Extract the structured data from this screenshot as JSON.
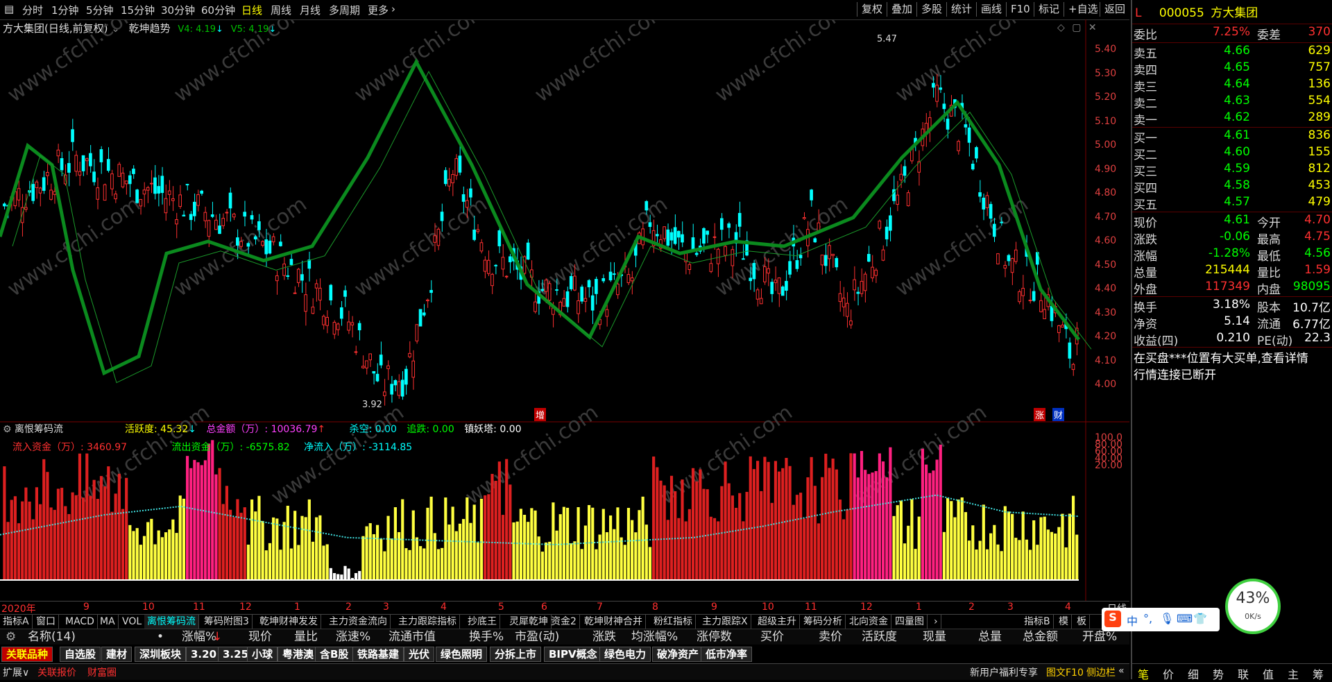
{
  "toolbar": {
    "periods": [
      "分时",
      "1分钟",
      "5分钟",
      "15分钟",
      "30分钟",
      "60分钟",
      "日线",
      "周线",
      "月线",
      "多周期",
      "更多"
    ],
    "active_period": "日线",
    "right_buttons": [
      "复权",
      "叠加",
      "多股",
      "统计",
      "画线",
      "F10",
      "标记",
      "+自选",
      "返回"
    ]
  },
  "main_chart": {
    "title": "方大集团(日线,前复权)",
    "indicator": "乾坤趋势",
    "v4_label": "V4: 4.19",
    "v5_label": "V5: 4.19",
    "high_mark": "5.47",
    "low_mark": "3.92",
    "price_ticks": [
      "5.40",
      "5.30",
      "5.20",
      "5.10",
      "5.00",
      "4.90",
      "4.80",
      "4.70",
      "4.60",
      "4.50",
      "4.40",
      "4.30",
      "4.20",
      "4.10",
      "4.00"
    ],
    "flags": [
      "增",
      "涨",
      "财"
    ],
    "watermark": "www.cfchi.com"
  },
  "sub_chart": {
    "name": "离恨筹码流",
    "active": "活跃度: 45.32",
    "total": "总金额（万）: 10036.79",
    "kill": "杀空: 0.00",
    "chase": "追跌: 0.00",
    "town": "镇妖塔: 0.00",
    "inflow": "流入资金（万）: 3460.97",
    "outflow": "流出资金（万）: -6575.82",
    "net": "净流入（万）: -3114.85",
    "ticks": [
      "100.0",
      "80.00",
      "60.00",
      "40.00",
      "20.00"
    ]
  },
  "time_axis": [
    "2020年",
    "9",
    "10",
    "11",
    "12",
    "1",
    "2",
    "3",
    "4",
    "5",
    "6",
    "7",
    "8",
    "9",
    "10",
    "11",
    "12",
    "1",
    "2",
    "3",
    "4"
  ],
  "time_axis_right": "日线",
  "indicator_tabs": [
    "指标A",
    "窗口",
    "MACD",
    "MA",
    "VOL",
    "离恨筹码流",
    "筹码附图3",
    "乾坤财神发发",
    "主力资金流向",
    "主力跟踪指标",
    "抄底王",
    "灵犀乾坤",
    "资金2",
    "乾坤财神合并",
    "粉红指标",
    "主力跟踪X",
    "超级主升",
    "筹码分析",
    "北向资金",
    "四量图"
  ],
  "active_indicator_tab": "离恨筹码流",
  "indicator_tabs_right": [
    "指标B",
    "模",
    "板"
  ],
  "columns": [
    "名称(14)",
    "•",
    "涨幅%",
    "现价",
    "量比",
    "涨速%",
    "流通市值",
    "换手%",
    "市盈(动)",
    "涨跌",
    "均涨幅%",
    "涨停数",
    "买价",
    "卖价",
    "活跃度",
    "现量",
    "总量",
    "总金额",
    "开盘%"
  ],
  "section_tabs": [
    "关联品种",
    "自选股",
    "建材",
    "深圳板块",
    "3.20",
    "3.25",
    "小球",
    "粤港澳",
    "含B股",
    "铁路基建",
    "光伏",
    "绿色照明",
    "分拆上市",
    "BIPV概念",
    "绿色电力",
    "破净资产",
    "低市净率"
  ],
  "active_section_tab": "关联品种",
  "status_bar": {
    "left": [
      "扩展∨",
      "关联报价",
      "财富圈"
    ],
    "right": [
      "新用户福利专享",
      "图文F10",
      "侧边栏",
      "«"
    ]
  },
  "quote": {
    "prefix": "L",
    "code": "000055",
    "name": "方大集团",
    "webi_label": "委比",
    "webi": "7.25%",
    "weicha_label": "委差",
    "weicha": "370",
    "asks": [
      {
        "label": "卖五",
        "price": "4.66",
        "vol": "629"
      },
      {
        "label": "卖四",
        "price": "4.65",
        "vol": "757"
      },
      {
        "label": "卖三",
        "price": "4.64",
        "vol": "136"
      },
      {
        "label": "卖二",
        "price": "4.63",
        "vol": "554"
      },
      {
        "label": "卖一",
        "price": "4.62",
        "vol": "289"
      }
    ],
    "bids": [
      {
        "label": "买一",
        "price": "4.61",
        "vol": "836"
      },
      {
        "label": "买二",
        "price": "4.60",
        "vol": "155"
      },
      {
        "label": "买三",
        "price": "4.59",
        "vol": "812"
      },
      {
        "label": "买四",
        "price": "4.58",
        "vol": "453"
      },
      {
        "label": "买五",
        "price": "4.57",
        "vol": "479"
      }
    ],
    "stats": [
      {
        "l1": "现价",
        "v1": "4.61",
        "c1": "#00ff00",
        "l2": "今开",
        "v2": "4.70",
        "c2": "#ff3030"
      },
      {
        "l1": "涨跌",
        "v1": "-0.06",
        "c1": "#00ff00",
        "l2": "最高",
        "v2": "4.75",
        "c2": "#ff3030"
      },
      {
        "l1": "涨幅",
        "v1": "-1.28%",
        "c1": "#00ff00",
        "l2": "最低",
        "v2": "4.56",
        "c2": "#00ff00"
      },
      {
        "l1": "总量",
        "v1": "215444",
        "c1": "#ffff00",
        "l2": "量比",
        "v2": "1.59",
        "c2": "#ff3030"
      },
      {
        "l1": "外盘",
        "v1": "117349",
        "c1": "#ff3030",
        "l2": "内盘",
        "v2": "98095",
        "c2": "#00ff00"
      }
    ],
    "stats2": [
      {
        "l1": "换手",
        "v1": "3.18%",
        "l2": "股本",
        "v2": "10.7亿"
      },
      {
        "l1": "净资",
        "v1": "5.14",
        "l2": "流通",
        "v2": "6.77亿"
      },
      {
        "l1": "收益(四)",
        "v1": "0.210",
        "l2": "PE(动)",
        "v2": "22.3"
      }
    ],
    "msg1": "在买盘***位置有大买单,查看详情",
    "msg2": "行情连接已断开",
    "bottom_tabs": [
      "笔",
      "价",
      "细",
      "势",
      "联",
      "值",
      "主",
      "筹"
    ]
  },
  "speed": {
    "percent": "43%",
    "rate": "0K/s"
  },
  "colors": {
    "up": "#ff3030",
    "down": "#00ffff",
    "green": "#00ff00",
    "yellow": "#ffff00",
    "trend": "#0b8a1e"
  }
}
